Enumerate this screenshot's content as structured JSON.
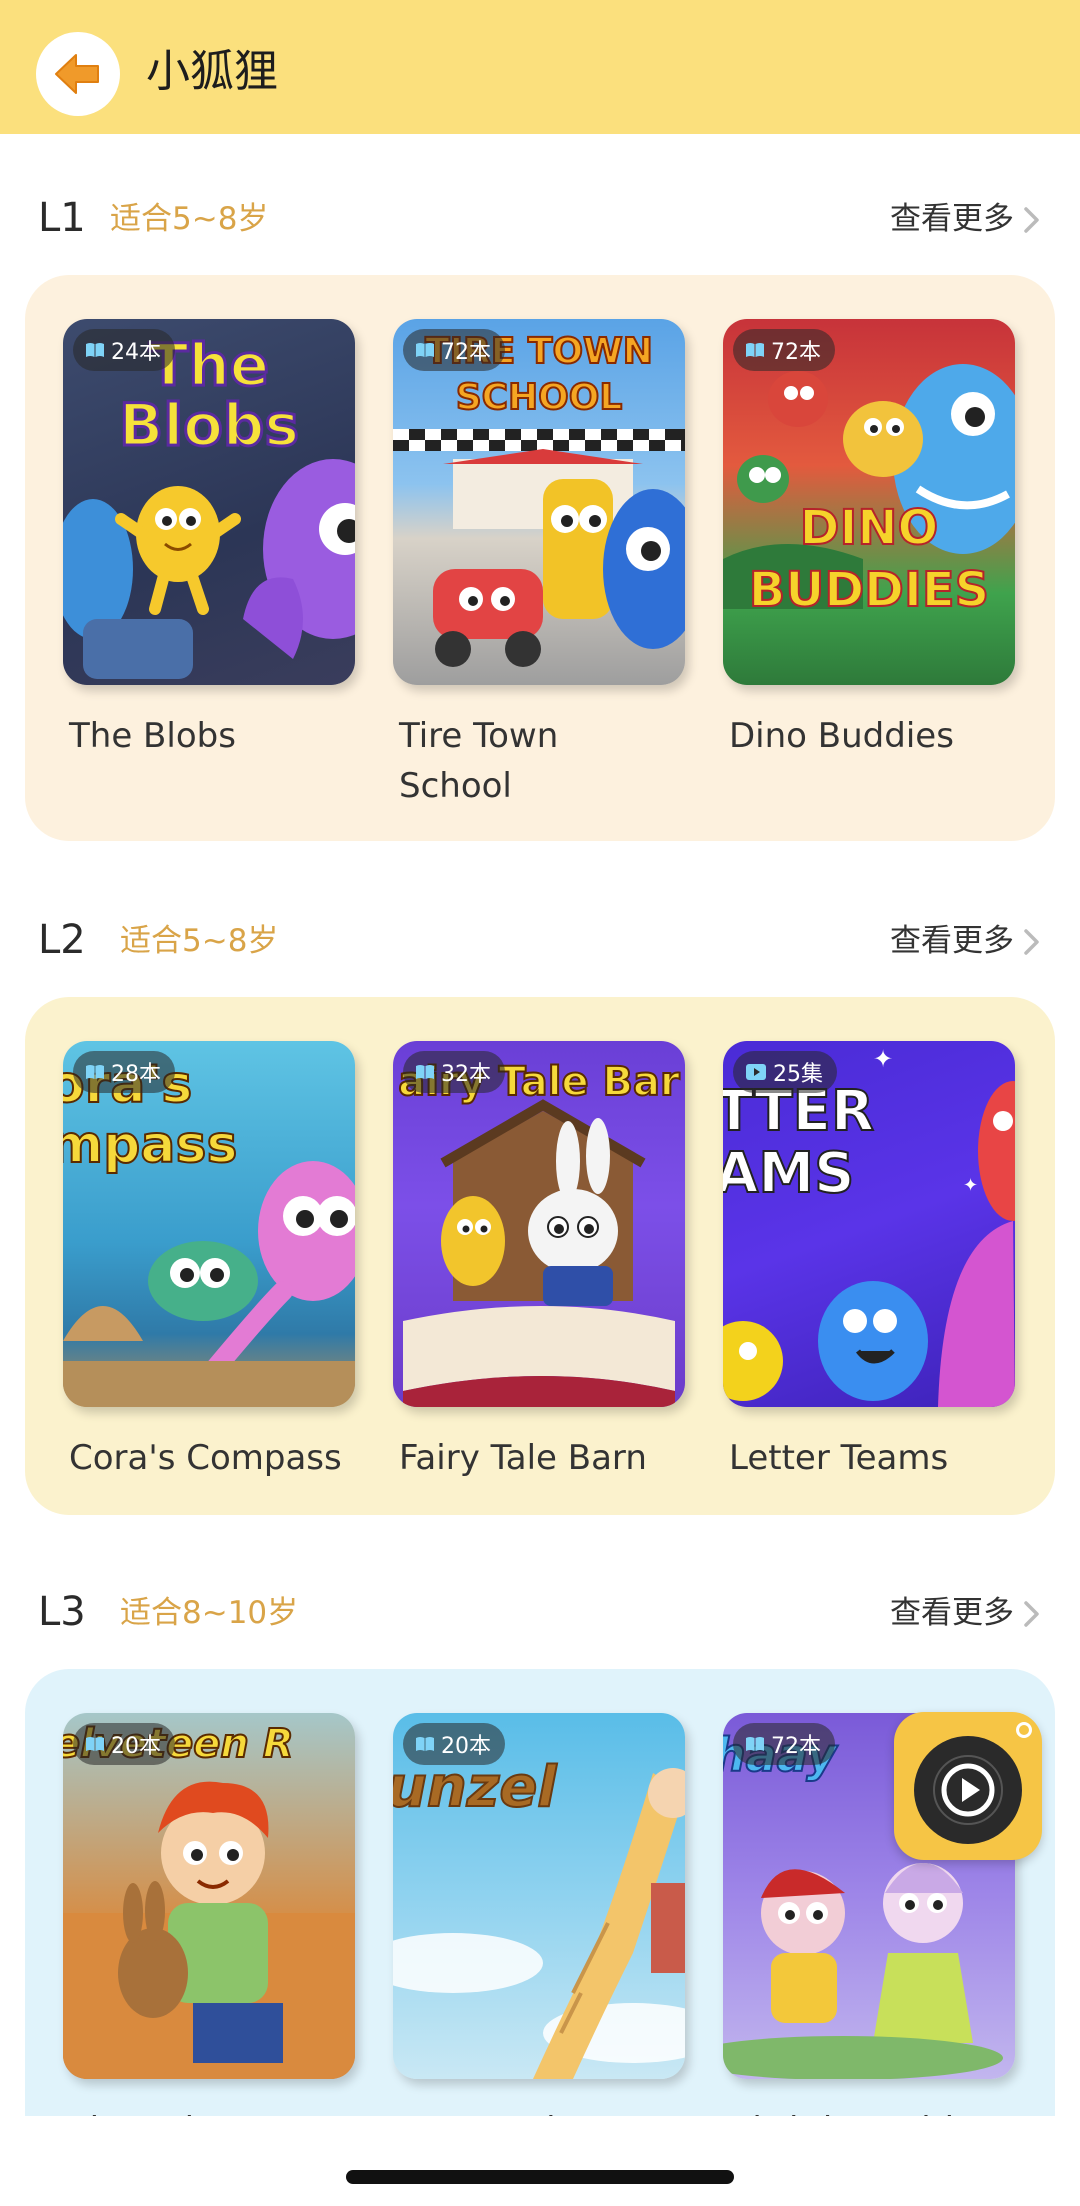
{
  "header": {
    "title": "小狐狸"
  },
  "sections": [
    {
      "level": "L1",
      "age": "适合5~8岁",
      "more": "查看更多",
      "panel_color": "#fdf1de",
      "books": [
        {
          "title": "The Blobs",
          "badge": "24本",
          "badge_type": "book",
          "cover_title": "The Blobs"
        },
        {
          "title": "Tire Town School",
          "badge": "72本",
          "badge_type": "book",
          "cover_title": "TIRE TOWN SCHOOL"
        },
        {
          "title": "Dino Buddies",
          "badge": "72本",
          "badge_type": "book",
          "cover_title": "DINO BUDDIES"
        }
      ]
    },
    {
      "level": "L2",
      "age": "适合5~8岁",
      "more": "查看更多",
      "panel_color": "#fbf2cd",
      "books": [
        {
          "title": "Cora's Compass",
          "badge": "28本",
          "badge_type": "book",
          "cover_title": "ora's mpass"
        },
        {
          "title": "Fairy Tale Barn",
          "badge": "32本",
          "badge_type": "book",
          "cover_title": "airy Tale Bar"
        },
        {
          "title": "Letter Teams",
          "badge": "25集",
          "badge_type": "video",
          "cover_title": "TTER AMS"
        }
      ]
    },
    {
      "level": "L3",
      "age": "适合8~10岁",
      "more": "查看更多",
      "panel_color": "#e0f3fb",
      "books": [
        {
          "title": "The Velveteen",
          "badge": "20本",
          "badge_type": "book",
          "cover_title": "elveteen R"
        },
        {
          "title": "Rapunzel",
          "badge": "20本",
          "badge_type": "book",
          "cover_title": "unzel"
        },
        {
          "title": "Birthday Fairies",
          "badge": "72本",
          "badge_type": "book",
          "cover_title": "haay"
        }
      ]
    }
  ]
}
